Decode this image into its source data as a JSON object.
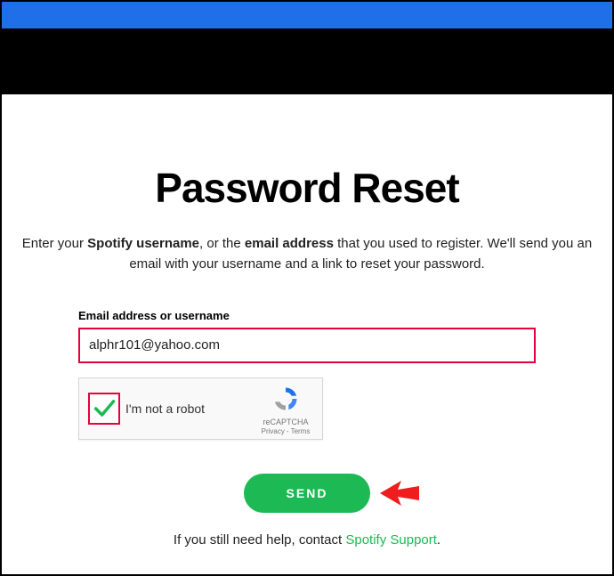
{
  "colors": {
    "accent_blue": "#1e6fe8",
    "brand_green": "#1db954",
    "highlight_red": "#e6003c"
  },
  "title": "Password Reset",
  "instruction": {
    "t1": "Enter your ",
    "b1": "Spotify username",
    "t2": ", or the ",
    "b2": "email address",
    "t3": " that you used to register. We'll send you an email with your username and a link to reset your password."
  },
  "form": {
    "label": "Email address or username",
    "value": "alphr101@yahoo.com"
  },
  "recaptcha": {
    "checked": true,
    "text": "I'm not a robot",
    "brand": "reCAPTCHA",
    "privacy": "Privacy",
    "terms": "Terms"
  },
  "send_button": "SEND",
  "help": {
    "text": "If you still need help, contact ",
    "link": "Spotify Support",
    "period": "."
  }
}
